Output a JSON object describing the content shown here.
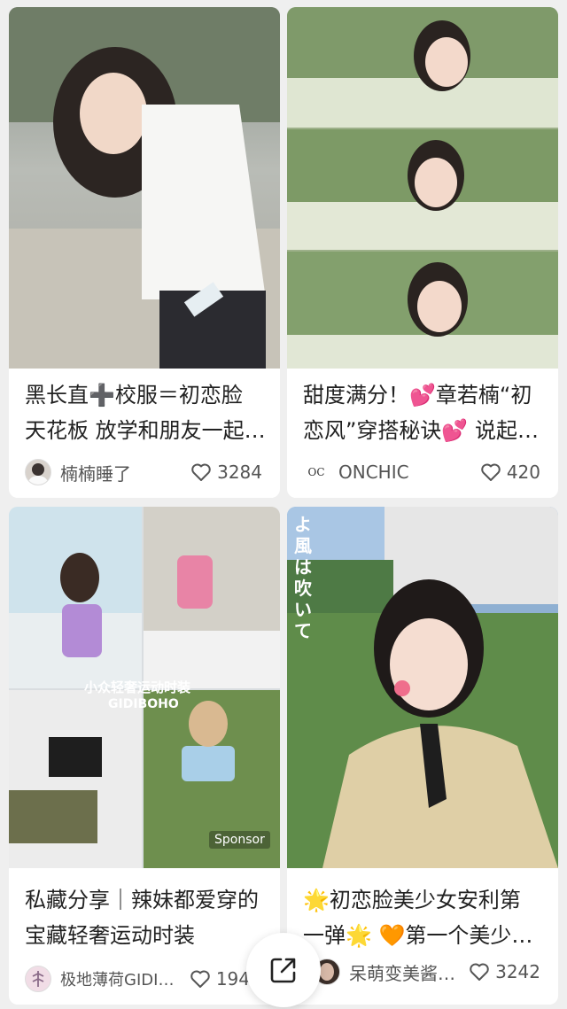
{
  "cards": [
    {
      "title_line1": "黑长直➕校服＝初恋脸",
      "title_line2": "天花板 放学和朋友一起…",
      "author": "楠楠睡了",
      "likes": "3284"
    },
    {
      "title_line1": "甜度满分！💕章若楠“初",
      "title_line2": "恋风”穿搭秘诀💕 说起…",
      "author": "ONCHIC",
      "likes": "420",
      "avatar_text": "OC"
    },
    {
      "title_line1": "私藏分享｜辣妹都爱穿的",
      "title_line2": "宝藏轻奢运动时装",
      "author": "极地薄荷GIDIB…",
      "likes": "194",
      "image_caption": "小众轻奢运动时装",
      "image_brand": "GIDIBOHO",
      "sponsor_tag": "Sponsor"
    },
    {
      "title_line1": "🌟初恋脸美少女安利第",
      "title_line2": "一弹🌟 🧡第一个美少…",
      "author": "呆萌变美酱…",
      "likes": "3242",
      "image_vertical_text": "よ風は吹いて"
    }
  ],
  "colors": {
    "background": "#efefef",
    "card": "#ffffff",
    "text": "#222222",
    "meta_text": "#555555"
  },
  "icons": {
    "like": "heart-outline-icon",
    "share": "share-external-icon"
  }
}
